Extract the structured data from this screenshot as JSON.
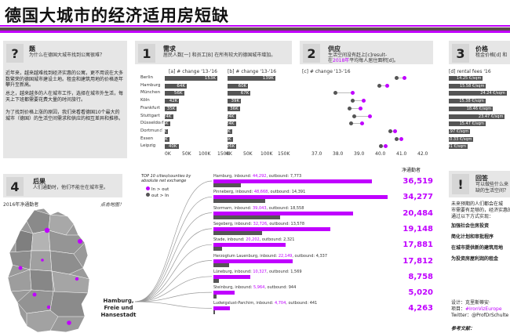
{
  "title": "德国大城市的经济适用房短缺",
  "colors": {
    "accent": "#c000ff",
    "bar": "#555555",
    "panel": "#e6e6e6"
  },
  "q_panel": {
    "num": "?",
    "heading": "题",
    "sub": "为什么在德国大城市找到公寓很难？",
    "p1": "近年来，越来越难找到经济实惠的公寓，更不用说在大多数繁荣的德国城市建设土地。租金和建筑用地的价格逐年攀升至新高。",
    "p2": "总之，越来越多的人在城市工作，选择在城市外生活，每天上下班都需要花费大量的时间旅行。",
    "p3": "为了找到价格上涨的原因，我们来看看德国10个最大的城市（德国）的生活空间需求和供应的相互差异和推移。"
  },
  "demand": {
    "num": "1",
    "heading": "需求",
    "sub": "居民人数[一] 和员工[B] 在所有较大的德国城市增加。",
    "label_a": "[a] # change '13-'16",
    "label_b": "[b] # change '13-'16",
    "cities": [
      "Berlin",
      "Hamburg",
      "München",
      "Köln",
      "Frankfurt",
      "Stuttgart",
      "Düsseldorf",
      "Dortmund",
      "Essen",
      "Leipzig"
    ],
    "a_values": [
      "153K",
      "64K",
      "56K",
      "42K",
      "35K",
      "24K",
      "15K",
      "10K",
      "13K",
      "40K"
    ],
    "b_values": [
      "139K",
      "60K",
      "67K",
      "39K",
      "36K",
      "24K",
      "24K",
      "13K",
      "15K",
      "26K"
    ],
    "axis_ticks": [
      "0K",
      "50K",
      "100K",
      "150K"
    ]
  },
  "supply": {
    "num": "2",
    "heading": "供应",
    "sub1": "生活空间没有赶上[c]result-",
    "sub2_pre": "在",
    "sub2_year": "2018年",
    "sub2_post": "平均每人居住面积[d]。",
    "label_c": "[c] # change '13-'16",
    "axis_ticks": [
      "37.0",
      "38.0",
      "39.0",
      "40.0",
      "41.0",
      "42.0"
    ]
  },
  "price": {
    "num": "3",
    "heading": "价格",
    "sub": "租金价格[d] 和",
    "label_d": "[d] rental fees '16",
    "values": [
      "14.25 €/sqm",
      "15.58 €/sqm",
      "24.24 €/sqm",
      "15.38 €/sqm",
      "18.46 €/sqm",
      "23.47 €/sqm",
      "15.47 €/sqm",
      "8.97 €/sqm",
      "10.33 €/sqm",
      "7.91 €/sqm"
    ]
  },
  "consequence": {
    "num": "4",
    "heading": "后果",
    "sub": "人们通勤时，他们不能住在城市里。",
    "map_label": "2016年净通勤者",
    "map_hint": "点击地图！",
    "hub_line1": "Hamburg,",
    "hub_line2": "Freie und",
    "hub_line3": "Hansestadt"
  },
  "flows": {
    "caption": "TOP 10 cities/counties by absolute net exchange",
    "legend_in": "In > out",
    "legend_out": "out > In",
    "net_header": "净通勤者",
    "rows": [
      {
        "name": "Hamburg, inbound: ",
        "inbound": "44,292",
        "sep": ", outbound: ",
        "outbound": "7,773",
        "net": "36,519"
      },
      {
        "name": "Pinneberg, inbound: ",
        "inbound": "48,668",
        "sep": ", outbound: ",
        "outbound": "14,391",
        "net": "34,277"
      },
      {
        "name": "Stormarn, inbound: ",
        "inbound": "39,043",
        "sep": ", outbound: ",
        "outbound": "18,558",
        "net": "20,484"
      },
      {
        "name": "Segeberg, inbound: ",
        "inbound": "32,726",
        "sep": ", outbound: ",
        "outbound": "13,578",
        "net": "19,148"
      },
      {
        "name": "Stade, inbound: ",
        "inbound": "20,202",
        "sep": ", outbound: ",
        "outbound": "2,321",
        "net": "17,881"
      },
      {
        "name": "Herzogtum Lauenburg, inbound: ",
        "inbound": "22,149",
        "sep": ", outbound: ",
        "outbound": "4,337",
        "net": "17,812"
      },
      {
        "name": "Lüneburg, inbound: ",
        "inbound": "10,327",
        "sep": ", outbound: ",
        "outbound": "1,569",
        "net": "8,758"
      },
      {
        "name": "Steinburg, inbound: ",
        "inbound": "5,964",
        "sep": ", outbound: ",
        "outbound": "944",
        "net": "5,020"
      },
      {
        "name": "Ludwigslust-Parchim, inbound: ",
        "inbound": "4,704",
        "sep": ", outbound: ",
        "outbound": "441",
        "net": "4,263"
      }
    ]
  },
  "answer": {
    "num": "!",
    "heading": "回答",
    "sub1": "可以做些什么来",
    "sub2": "缺的生活空间？",
    "body1": "未来预期的人们都会在城",
    "body2": "市需要有足够的，经济实惠的",
    "body3": "通过以下方式实现：",
    "item1": "加强社会住房投资",
    "item2": "简化计划和审批程序",
    "item3": "在城市提供新的建筑用地",
    "item4": "为投资房屋利润的租金",
    "credit1": "设计：克里斯蒂安·",
    "credit2": "项目：",
    "credit2_tag": "#IronVizEurope",
    "credit3": "Twitter：@ProfDrSchulte",
    "refs": "参考文献："
  }
}
